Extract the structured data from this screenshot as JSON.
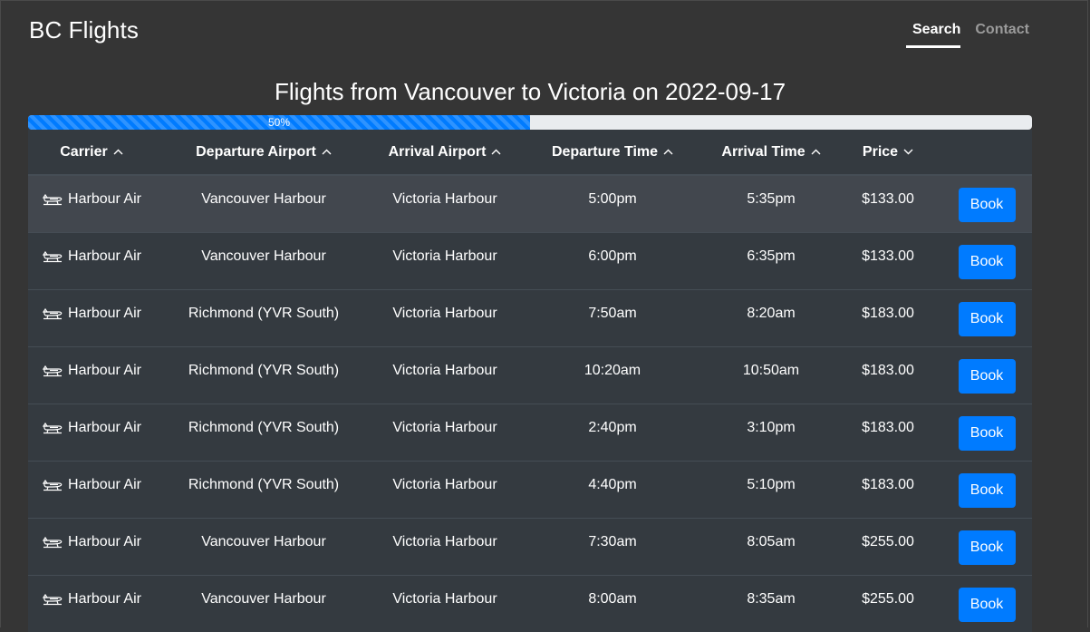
{
  "brand": "BC Flights",
  "nav": [
    {
      "label": "Search",
      "active": true
    },
    {
      "label": "Contact",
      "active": false
    }
  ],
  "page_title": "Flights from Vancouver to Victoria on 2022-09-17",
  "progress": {
    "percent": 50,
    "label": "50%"
  },
  "table": {
    "columns": [
      {
        "label": "Carrier",
        "sort": "asc",
        "caret_icon": "chevron-up-icon"
      },
      {
        "label": "Departure Airport",
        "sort": "asc",
        "caret_icon": "chevron-up-icon"
      },
      {
        "label": "Arrival Airport",
        "sort": "asc",
        "caret_icon": "chevron-up-icon"
      },
      {
        "label": "Departure Time",
        "sort": "asc",
        "caret_icon": "chevron-up-icon"
      },
      {
        "label": "Arrival Time",
        "sort": "asc",
        "caret_icon": "chevron-up-icon"
      },
      {
        "label": "Price",
        "sort": "desc",
        "caret_icon": "chevron-down-icon"
      },
      {
        "label": "",
        "sort": null
      }
    ],
    "rows": [
      {
        "carrier": "Harbour Air",
        "carrier_icon": "seaplane-icon",
        "departure_airport": "Vancouver Harbour",
        "arrival_airport": "Victoria Harbour",
        "departure_time": "5:00pm",
        "arrival_time": "5:35pm",
        "price": "$133.00",
        "action": "Book"
      },
      {
        "carrier": "Harbour Air",
        "carrier_icon": "seaplane-icon",
        "departure_airport": "Vancouver Harbour",
        "arrival_airport": "Victoria Harbour",
        "departure_time": "6:00pm",
        "arrival_time": "6:35pm",
        "price": "$133.00",
        "action": "Book"
      },
      {
        "carrier": "Harbour Air",
        "carrier_icon": "seaplane-icon",
        "departure_airport": "Richmond (YVR South)",
        "arrival_airport": "Victoria Harbour",
        "departure_time": "7:50am",
        "arrival_time": "8:20am",
        "price": "$183.00",
        "action": "Book"
      },
      {
        "carrier": "Harbour Air",
        "carrier_icon": "seaplane-icon",
        "departure_airport": "Richmond (YVR South)",
        "arrival_airport": "Victoria Harbour",
        "departure_time": "10:20am",
        "arrival_time": "10:50am",
        "price": "$183.00",
        "action": "Book"
      },
      {
        "carrier": "Harbour Air",
        "carrier_icon": "seaplane-icon",
        "departure_airport": "Richmond (YVR South)",
        "arrival_airport": "Victoria Harbour",
        "departure_time": "2:40pm",
        "arrival_time": "3:10pm",
        "price": "$183.00",
        "action": "Book"
      },
      {
        "carrier": "Harbour Air",
        "carrier_icon": "seaplane-icon",
        "departure_airport": "Richmond (YVR South)",
        "arrival_airport": "Victoria Harbour",
        "departure_time": "4:40pm",
        "arrival_time": "5:10pm",
        "price": "$183.00",
        "action": "Book"
      },
      {
        "carrier": "Harbour Air",
        "carrier_icon": "seaplane-icon",
        "departure_airport": "Vancouver Harbour",
        "arrival_airport": "Victoria Harbour",
        "departure_time": "7:30am",
        "arrival_time": "8:05am",
        "price": "$255.00",
        "action": "Book"
      },
      {
        "carrier": "Harbour Air",
        "carrier_icon": "seaplane-icon",
        "departure_airport": "Vancouver Harbour",
        "arrival_airport": "Victoria Harbour",
        "departure_time": "8:00am",
        "arrival_time": "8:35am",
        "price": "$255.00",
        "action": "Book"
      }
    ]
  },
  "colors": {
    "page_bg": "#353535",
    "table_bg": "#343a40",
    "row_hover_bg": "#42474e",
    "accent": "#007bff",
    "progress_track": "#e9ecef",
    "nav_inactive": "#9b9b9b"
  }
}
